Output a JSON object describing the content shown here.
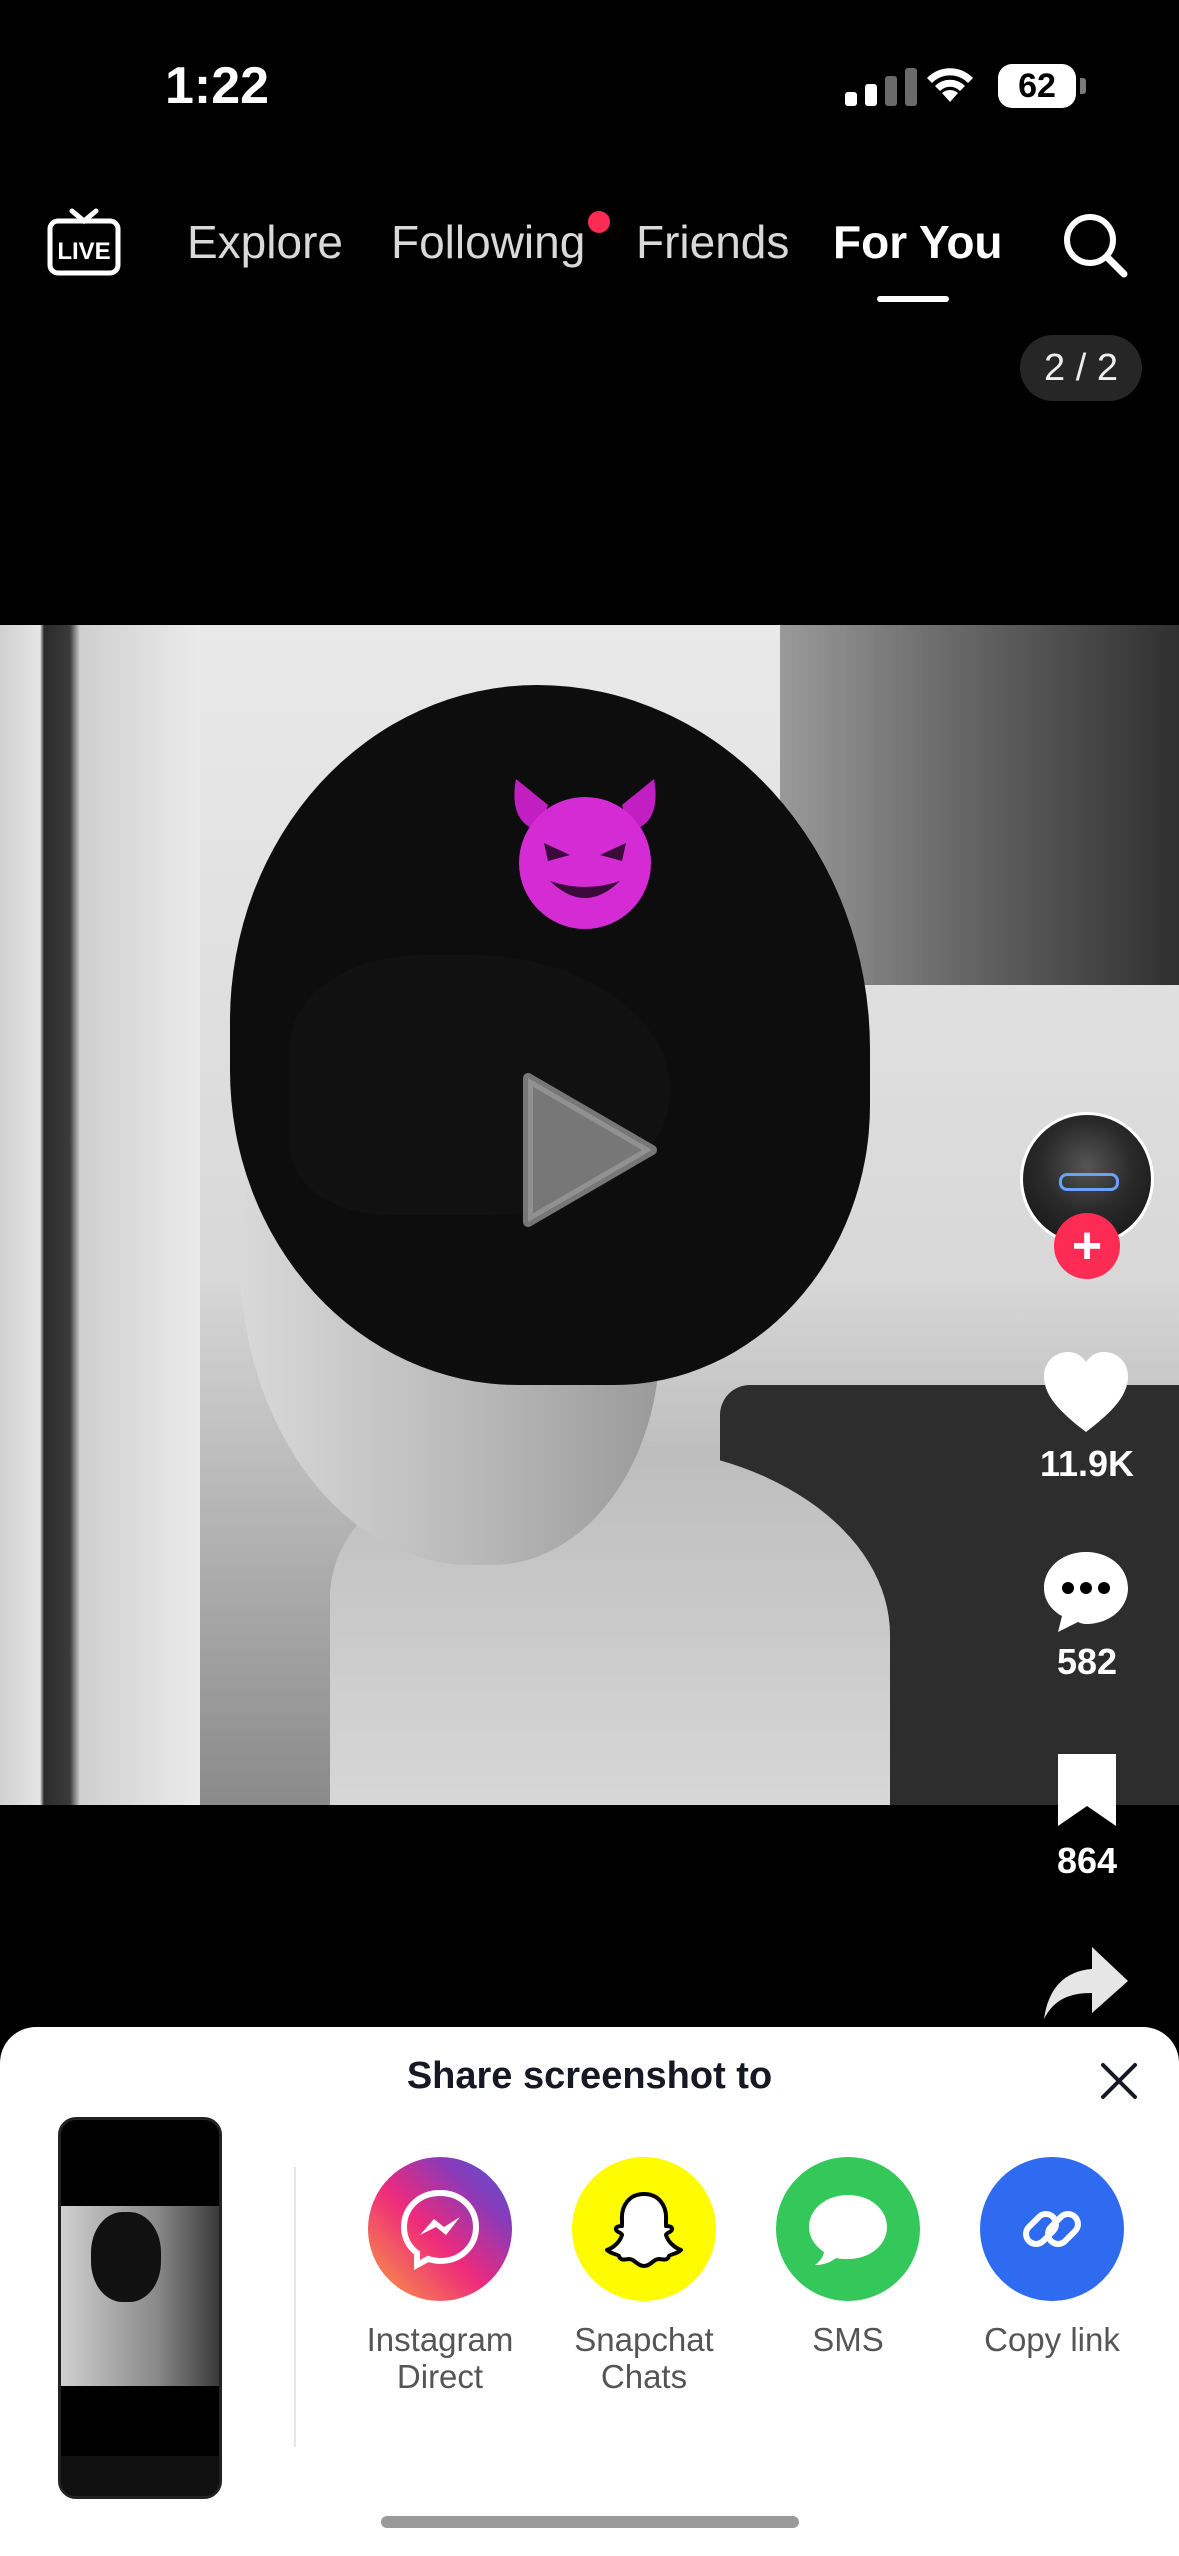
{
  "status_bar": {
    "time": "1:22",
    "battery": "62"
  },
  "top_nav": {
    "tabs": [
      {
        "label": "Explore"
      },
      {
        "label": "Following"
      },
      {
        "label": "Friends"
      },
      {
        "label": "For You"
      }
    ],
    "active_tab": "For You",
    "live_icon": "live-tv-icon",
    "search_icon": "search-icon"
  },
  "photo_counter": "2 / 2",
  "overlay": {
    "sticker": "smiling-devil-emoji",
    "play_icon": "play-icon"
  },
  "actions": {
    "likes": "11.9K",
    "comments": "582",
    "saves": "864"
  },
  "share_sheet": {
    "title": "Share screenshot to",
    "options": [
      {
        "label_line1": "Instagram",
        "label_line2": "Direct",
        "color": "#c13584"
      },
      {
        "label_line1": "Snapchat",
        "label_line2": "Chats",
        "color": "#fffc00"
      },
      {
        "label_line1": "SMS",
        "label_line2": "",
        "color": "#34c759"
      },
      {
        "label_line1": "Copy link",
        "label_line2": "",
        "color": "#2e6bf0"
      }
    ]
  },
  "colors": {
    "accent": "#fe2c55",
    "background": "#000000",
    "sheet": "#ffffff"
  }
}
